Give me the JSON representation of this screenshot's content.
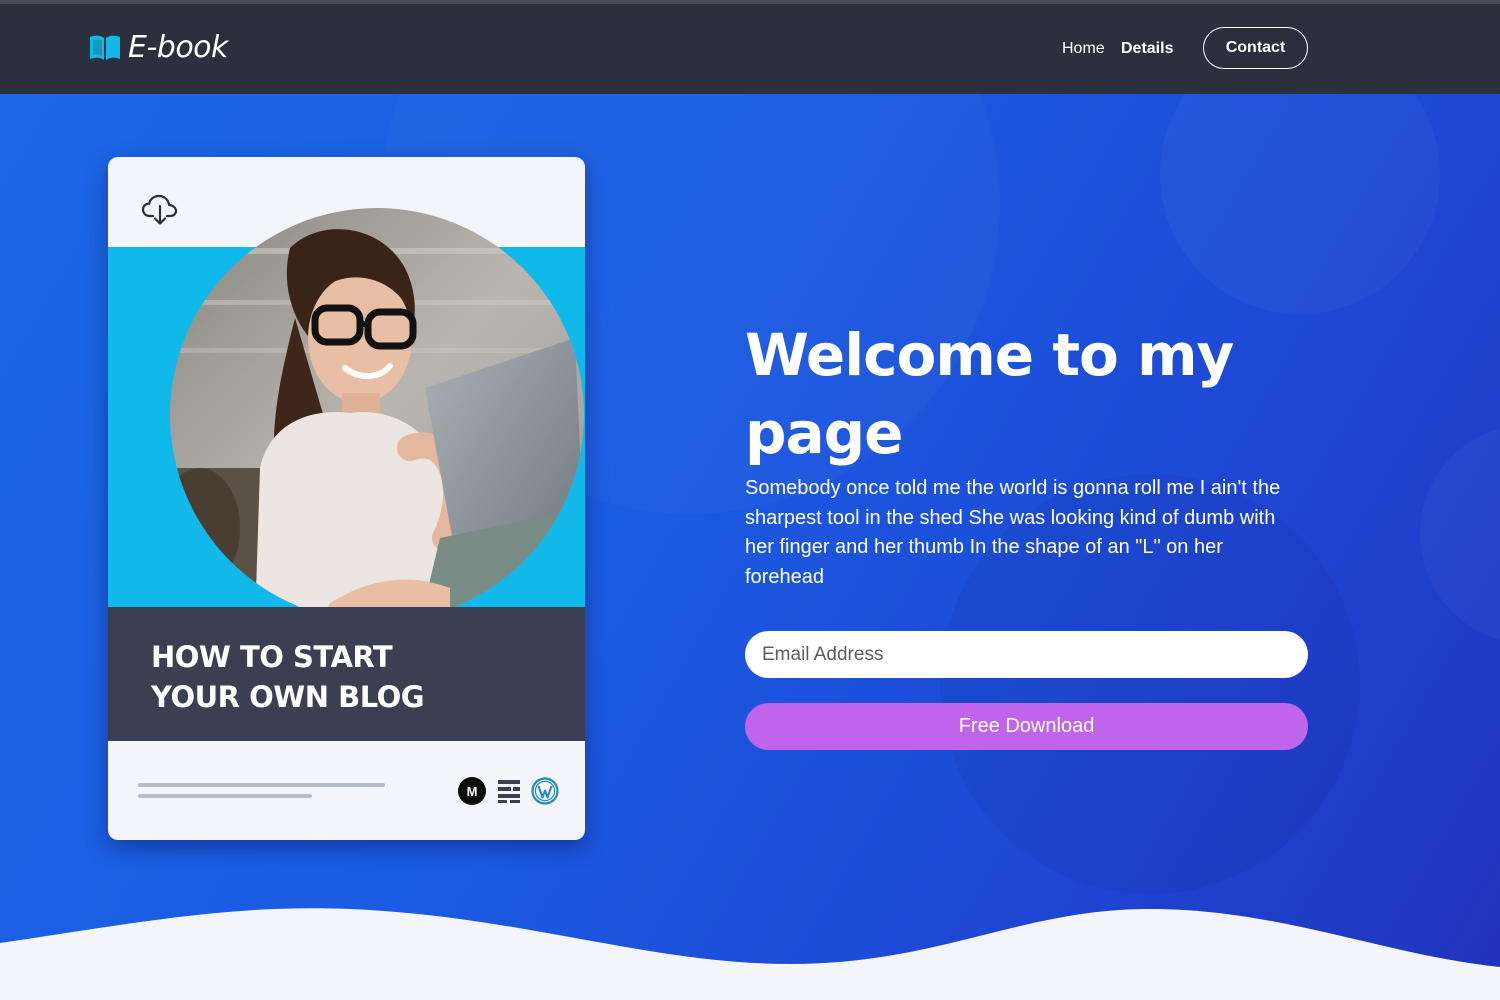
{
  "header": {
    "logo_text": "E-book",
    "logo_icon": "open-book-icon",
    "nav": {
      "home": "Home",
      "details": "Details",
      "contact": "Contact"
    }
  },
  "card": {
    "download_icon": "cloud-download-icon",
    "title_line1": "HOW TO START",
    "title_line2": "YOUR OWN BLOG",
    "platform_icons": [
      "medium-icon",
      "lines-icon",
      "wordpress-icon"
    ],
    "medium_letter": "M"
  },
  "hero": {
    "headline": "Welcome to my page",
    "paragraph": "Somebody once told me the world is gonna roll me I ain't the sharpest tool in the shed She was looking kind of dumb with her finger and her thumb In the shape of an \"L\" on her forehead",
    "email_placeholder": "Email Address",
    "download_label": "Free Download"
  },
  "colors": {
    "navbar": "#2c303e",
    "hero_gradient_start": "#1c67e7",
    "hero_gradient_end": "#2233bd",
    "accent_cyan": "#10b9ea",
    "download_button": "#c064ec",
    "card_title_band": "#3c3f52"
  }
}
